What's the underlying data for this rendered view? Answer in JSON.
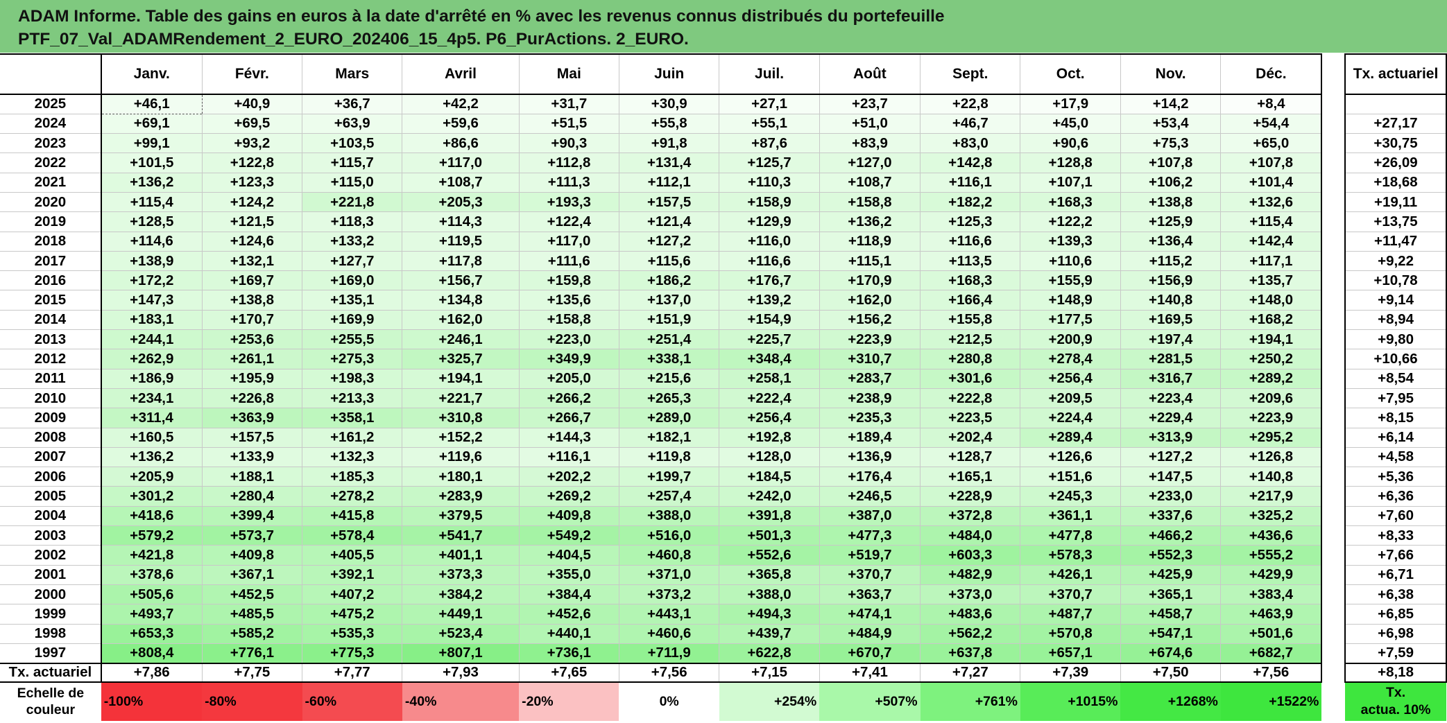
{
  "title": {
    "line1": "ADAM Informe. Table des gains en euros à la date d'arrêté en % avec les revenus connus distribués du portefeuille",
    "line2": "PTF_07_Val_ADAMRendement_2_EURO_202406_15_4p5. P6_PurActions. 2_EURO."
  },
  "chart_data": {
    "type": "table",
    "months": [
      "Janv.",
      "Févr.",
      "Mars",
      "Avril",
      "Mai",
      "Juin",
      "Juil.",
      "Août",
      "Sept.",
      "Oct.",
      "Nov.",
      "Déc."
    ],
    "actuarial_header": "Tx. actuariel",
    "rows": [
      {
        "year": "2025",
        "values": [
          "+46,1",
          "+40,9",
          "+36,7",
          "+42,2",
          "+31,7",
          "+30,9",
          "+27,1",
          "+23,7",
          "+22,8",
          "+17,9",
          "+14,2",
          "+8,4"
        ],
        "actuarial": ""
      },
      {
        "year": "2024",
        "values": [
          "+69,1",
          "+69,5",
          "+63,9",
          "+59,6",
          "+51,5",
          "+55,8",
          "+55,1",
          "+51,0",
          "+46,7",
          "+45,0",
          "+53,4",
          "+54,4"
        ],
        "actuarial": "+27,17"
      },
      {
        "year": "2023",
        "values": [
          "+99,1",
          "+93,2",
          "+103,5",
          "+86,6",
          "+90,3",
          "+91,8",
          "+87,6",
          "+83,9",
          "+83,0",
          "+90,6",
          "+75,3",
          "+65,0"
        ],
        "actuarial": "+30,75"
      },
      {
        "year": "2022",
        "values": [
          "+101,5",
          "+122,8",
          "+115,7",
          "+117,0",
          "+112,8",
          "+131,4",
          "+125,7",
          "+127,0",
          "+142,8",
          "+128,8",
          "+107,8",
          "+107,8"
        ],
        "actuarial": "+26,09"
      },
      {
        "year": "2021",
        "values": [
          "+136,2",
          "+123,3",
          "+115,0",
          "+108,7",
          "+111,3",
          "+112,1",
          "+110,3",
          "+108,7",
          "+116,1",
          "+107,1",
          "+106,2",
          "+101,4"
        ],
        "actuarial": "+18,68"
      },
      {
        "year": "2020",
        "values": [
          "+115,4",
          "+124,2",
          "+221,8",
          "+205,3",
          "+193,3",
          "+157,5",
          "+158,9",
          "+158,8",
          "+182,2",
          "+168,3",
          "+138,8",
          "+132,6"
        ],
        "actuarial": "+19,11"
      },
      {
        "year": "2019",
        "values": [
          "+128,5",
          "+121,5",
          "+118,3",
          "+114,3",
          "+122,4",
          "+121,4",
          "+129,9",
          "+136,2",
          "+125,3",
          "+122,2",
          "+125,9",
          "+115,4"
        ],
        "actuarial": "+13,75"
      },
      {
        "year": "2018",
        "values": [
          "+114,6",
          "+124,6",
          "+133,2",
          "+119,5",
          "+117,0",
          "+127,2",
          "+116,0",
          "+118,9",
          "+116,6",
          "+139,3",
          "+136,4",
          "+142,4"
        ],
        "actuarial": "+11,47"
      },
      {
        "year": "2017",
        "values": [
          "+138,9",
          "+132,1",
          "+127,7",
          "+117,8",
          "+111,6",
          "+115,6",
          "+116,6",
          "+115,1",
          "+113,5",
          "+110,6",
          "+115,2",
          "+117,1"
        ],
        "actuarial": "+9,22"
      },
      {
        "year": "2016",
        "values": [
          "+172,2",
          "+169,7",
          "+169,0",
          "+156,7",
          "+159,8",
          "+186,2",
          "+176,7",
          "+170,9",
          "+168,3",
          "+155,9",
          "+156,9",
          "+135,7"
        ],
        "actuarial": "+10,78"
      },
      {
        "year": "2015",
        "values": [
          "+147,3",
          "+138,8",
          "+135,1",
          "+134,8",
          "+135,6",
          "+137,0",
          "+139,2",
          "+162,0",
          "+166,4",
          "+148,9",
          "+140,8",
          "+148,0"
        ],
        "actuarial": "+9,14"
      },
      {
        "year": "2014",
        "values": [
          "+183,1",
          "+170,7",
          "+169,9",
          "+162,0",
          "+158,8",
          "+151,9",
          "+154,9",
          "+156,2",
          "+155,8",
          "+177,5",
          "+169,5",
          "+168,2"
        ],
        "actuarial": "+8,94"
      },
      {
        "year": "2013",
        "values": [
          "+244,1",
          "+253,6",
          "+255,5",
          "+246,1",
          "+223,0",
          "+251,4",
          "+225,7",
          "+223,9",
          "+212,5",
          "+200,9",
          "+197,4",
          "+194,1"
        ],
        "actuarial": "+9,80"
      },
      {
        "year": "2012",
        "values": [
          "+262,9",
          "+261,1",
          "+275,3",
          "+325,7",
          "+349,9",
          "+338,1",
          "+348,4",
          "+310,7",
          "+280,8",
          "+278,4",
          "+281,5",
          "+250,2"
        ],
        "actuarial": "+10,66"
      },
      {
        "year": "2011",
        "values": [
          "+186,9",
          "+195,9",
          "+198,3",
          "+194,1",
          "+205,0",
          "+215,6",
          "+258,1",
          "+283,7",
          "+301,6",
          "+256,4",
          "+316,7",
          "+289,2"
        ],
        "actuarial": "+8,54"
      },
      {
        "year": "2010",
        "values": [
          "+234,1",
          "+226,8",
          "+213,3",
          "+221,7",
          "+266,2",
          "+265,3",
          "+222,4",
          "+238,9",
          "+222,8",
          "+209,5",
          "+223,4",
          "+209,6"
        ],
        "actuarial": "+7,95"
      },
      {
        "year": "2009",
        "values": [
          "+311,4",
          "+363,9",
          "+358,1",
          "+310,8",
          "+266,7",
          "+289,0",
          "+256,4",
          "+235,3",
          "+223,5",
          "+224,4",
          "+229,4",
          "+223,9"
        ],
        "actuarial": "+8,15"
      },
      {
        "year": "2008",
        "values": [
          "+160,5",
          "+157,5",
          "+161,2",
          "+152,2",
          "+144,3",
          "+182,1",
          "+192,8",
          "+189,4",
          "+202,4",
          "+289,4",
          "+313,9",
          "+295,2"
        ],
        "actuarial": "+6,14"
      },
      {
        "year": "2007",
        "values": [
          "+136,2",
          "+133,9",
          "+132,3",
          "+119,6",
          "+116,1",
          "+119,8",
          "+128,0",
          "+136,9",
          "+128,7",
          "+126,6",
          "+127,2",
          "+126,8"
        ],
        "actuarial": "+4,58"
      },
      {
        "year": "2006",
        "values": [
          "+205,9",
          "+188,1",
          "+185,3",
          "+180,1",
          "+202,2",
          "+199,7",
          "+184,5",
          "+176,4",
          "+165,1",
          "+151,6",
          "+147,5",
          "+140,8"
        ],
        "actuarial": "+5,36"
      },
      {
        "year": "2005",
        "values": [
          "+301,2",
          "+280,4",
          "+278,2",
          "+283,9",
          "+269,2",
          "+257,4",
          "+242,0",
          "+246,5",
          "+228,9",
          "+245,3",
          "+233,0",
          "+217,9"
        ],
        "actuarial": "+6,36"
      },
      {
        "year": "2004",
        "values": [
          "+418,6",
          "+399,4",
          "+415,8",
          "+379,5",
          "+409,8",
          "+388,0",
          "+391,8",
          "+387,0",
          "+372,8",
          "+361,1",
          "+337,6",
          "+325,2"
        ],
        "actuarial": "+7,60"
      },
      {
        "year": "2003",
        "values": [
          "+579,2",
          "+573,7",
          "+578,4",
          "+541,7",
          "+549,2",
          "+516,0",
          "+501,3",
          "+477,3",
          "+484,0",
          "+477,8",
          "+466,2",
          "+436,6"
        ],
        "actuarial": "+8,33"
      },
      {
        "year": "2002",
        "values": [
          "+421,8",
          "+409,8",
          "+405,5",
          "+401,1",
          "+404,5",
          "+460,8",
          "+552,6",
          "+519,7",
          "+603,3",
          "+578,3",
          "+552,3",
          "+555,2"
        ],
        "actuarial": "+7,66"
      },
      {
        "year": "2001",
        "values": [
          "+378,6",
          "+367,1",
          "+392,1",
          "+373,3",
          "+355,0",
          "+371,0",
          "+365,8",
          "+370,7",
          "+482,9",
          "+426,1",
          "+425,9",
          "+429,9"
        ],
        "actuarial": "+6,71"
      },
      {
        "year": "2000",
        "values": [
          "+505,6",
          "+452,5",
          "+407,2",
          "+384,2",
          "+384,4",
          "+373,2",
          "+388,0",
          "+363,7",
          "+373,0",
          "+370,7",
          "+365,1",
          "+383,4"
        ],
        "actuarial": "+6,38"
      },
      {
        "year": "1999",
        "values": [
          "+493,7",
          "+485,5",
          "+475,2",
          "+449,1",
          "+452,6",
          "+443,1",
          "+494,3",
          "+474,1",
          "+483,6",
          "+487,7",
          "+458,7",
          "+463,9"
        ],
        "actuarial": "+6,85"
      },
      {
        "year": "1998",
        "values": [
          "+653,3",
          "+585,2",
          "+535,3",
          "+523,4",
          "+440,1",
          "+460,6",
          "+439,7",
          "+484,9",
          "+562,2",
          "+570,8",
          "+547,1",
          "+501,6"
        ],
        "actuarial": "+6,98"
      },
      {
        "year": "1997",
        "values": [
          "+808,4",
          "+776,1",
          "+775,3",
          "+807,1",
          "+736,1",
          "+711,9",
          "+622,8",
          "+670,7",
          "+637,8",
          "+657,1",
          "+674,6",
          "+682,7"
        ],
        "actuarial": "+7,59"
      }
    ],
    "summary": {
      "label": "Tx. actuariel",
      "values": [
        "+7,86",
        "+7,75",
        "+7,77",
        "+7,93",
        "+7,65",
        "+7,56",
        "+7,15",
        "+7,41",
        "+7,27",
        "+7,39",
        "+7,50",
        "+7,56"
      ],
      "actuarial": "+8,18"
    },
    "scale": {
      "label_line1": "Echelle de",
      "label_line2": "couleur",
      "steps": [
        {
          "label": "-100%",
          "color": "#f4333a",
          "align": "left"
        },
        {
          "label": "-80%",
          "color": "#f4383e",
          "align": "left"
        },
        {
          "label": "-60%",
          "color": "#f44b50",
          "align": "left"
        },
        {
          "label": "-40%",
          "color": "#f78a8c",
          "align": "left"
        },
        {
          "label": "-20%",
          "color": "#fbc1c2",
          "align": "left"
        },
        {
          "label": "0%",
          "color": "#ffffff",
          "align": "center"
        },
        {
          "label": "+254%",
          "color": "#d2fad2",
          "align": "right"
        },
        {
          "label": "+507%",
          "color": "#a9f8a9",
          "align": "right"
        },
        {
          "label": "+761%",
          "color": "#7ef27e",
          "align": "right"
        },
        {
          "label": "+1015%",
          "color": "#58ec58",
          "align": "right"
        },
        {
          "label": "+1268%",
          "color": "#44e844",
          "align": "right"
        },
        {
          "label": "+1522%",
          "color": "#3ee63e",
          "align": "right"
        }
      ],
      "actuarial_line1": "Tx.",
      "actuarial_line2": "actua. 10%"
    },
    "color_scale_max": 1522,
    "color_low": "#ffffff",
    "color_high": "#3ee63e",
    "highlight_cell": {
      "year": "2025",
      "month": "Janv."
    }
  }
}
